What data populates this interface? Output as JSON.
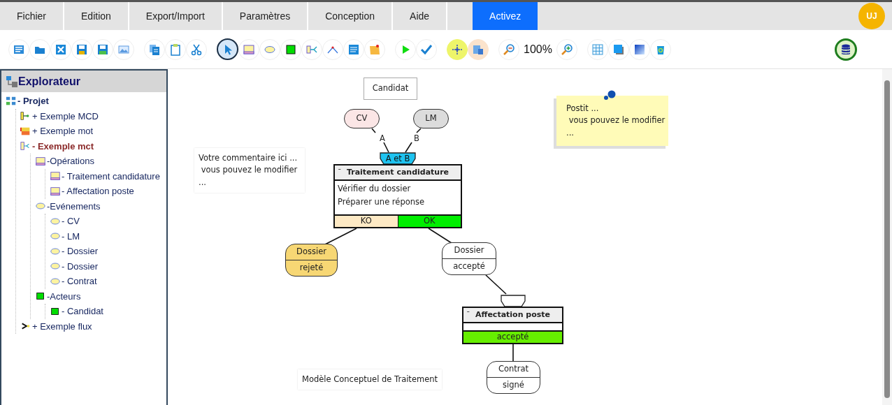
{
  "menu": [
    {
      "label": "Fichier",
      "kind": "menu",
      "selected": false
    },
    {
      "label": "Edition",
      "kind": "menu",
      "selected": false
    },
    {
      "label": "Export/Import",
      "kind": "menu",
      "selected": false
    },
    {
      "label": "Paramètres",
      "kind": "menu",
      "selected": false
    },
    {
      "label": "Conception",
      "kind": "menu",
      "selected": false
    },
    {
      "label": "Aide",
      "kind": "menu",
      "selected": false
    },
    {
      "label": "Activez",
      "kind": "action",
      "selected": true
    }
  ],
  "user": {
    "initials": "UJ"
  },
  "toolbar": {
    "groups": [
      [
        {
          "kind": "form",
          "selected": false
        },
        {
          "kind": "folder",
          "selected": false
        },
        {
          "kind": "close",
          "selected": false
        },
        {
          "kind": "save",
          "selected": false
        },
        {
          "kind": "save-as",
          "selected": false
        },
        {
          "kind": "image",
          "selected": false
        }
      ],
      [
        {
          "kind": "copy",
          "selected": false
        },
        {
          "kind": "paste",
          "selected": false
        },
        {
          "kind": "cut",
          "selected": false
        }
      ],
      [
        {
          "kind": "pointer",
          "selected": true
        },
        {
          "kind": "operation",
          "selected": false
        },
        {
          "kind": "ellipse",
          "selected": false
        },
        {
          "kind": "square",
          "selected": false
        },
        {
          "kind": "branch",
          "selected": false
        },
        {
          "kind": "angle",
          "selected": false
        },
        {
          "kind": "comment",
          "selected": false
        },
        {
          "kind": "note",
          "selected": false
        }
      ],
      [
        {
          "kind": "play",
          "selected": false
        },
        {
          "kind": "check",
          "selected": false
        }
      ],
      [
        {
          "kind": "move",
          "selected": false,
          "color": "#eef56a"
        },
        {
          "kind": "layout",
          "selected": false,
          "color": "#fbe3cc"
        }
      ],
      [
        {
          "kind": "zoom-out",
          "selected": false
        },
        {
          "kind": "text",
          "text": "100%"
        },
        {
          "kind": "zoom-in",
          "selected": false
        }
      ],
      [
        {
          "kind": "grid",
          "selected": false
        },
        {
          "kind": "shadow",
          "selected": false
        },
        {
          "kind": "gradient",
          "selected": false
        },
        {
          "kind": "trash",
          "selected": false
        }
      ]
    ],
    "end_tool": {
      "kind": "database"
    }
  },
  "explorer": {
    "title": "Explorateur",
    "tree": [
      {
        "label": "- Projet",
        "kind": "project",
        "selected": false,
        "children": [
          {
            "label": "+ Exemple MCD",
            "kind": "mcd",
            "selected": false
          },
          {
            "label": "+ Exemple mot",
            "kind": "mot",
            "selected": false
          },
          {
            "label": "- Exemple mct",
            "kind": "mct",
            "selected": true,
            "children": [
              {
                "label": "-Opérations",
                "kind": "operation",
                "selected": false,
                "children": [
                  {
                    "label": "- Traitement candidature",
                    "kind": "operation",
                    "selected": false
                  },
                  {
                    "label": "- Affectation poste",
                    "kind": "operation",
                    "selected": false
                  }
                ]
              },
              {
                "label": "-Evénements",
                "kind": "event",
                "selected": false,
                "children": [
                  {
                    "label": "- CV",
                    "kind": "event",
                    "selected": false
                  },
                  {
                    "label": "- LM",
                    "kind": "event",
                    "selected": false
                  },
                  {
                    "label": "- Dossier",
                    "kind": "event",
                    "selected": false
                  },
                  {
                    "label": "- Dossier",
                    "kind": "event",
                    "selected": false
                  },
                  {
                    "label": "- Contrat",
                    "kind": "event",
                    "selected": false
                  }
                ]
              },
              {
                "label": "-Acteurs",
                "kind": "actor",
                "selected": false,
                "children": [
                  {
                    "label": "- Candidat",
                    "kind": "actor",
                    "selected": false
                  }
                ]
              }
            ]
          },
          {
            "label": "+ Exemple flux",
            "kind": "flux",
            "selected": false
          }
        ]
      }
    ]
  },
  "diagram": {
    "actors": [
      {
        "label": "Candidat"
      }
    ],
    "events": [
      {
        "label": "CV",
        "color": "#fbe6e6"
      },
      {
        "label": "LM",
        "color": "#dcdcdc"
      },
      {
        "label": "Dossier",
        "state": "rejeté",
        "color": "#f7d774"
      },
      {
        "label": "Dossier",
        "state": "accepté",
        "color": "#ffffff"
      },
      {
        "label": "Contrat",
        "state": "signé",
        "color": "#ffffff"
      }
    ],
    "links": [
      {
        "label": "A"
      },
      {
        "label": "B"
      }
    ],
    "operations": [
      {
        "toggle": "ˉ",
        "title": "Traitement candidature",
        "synchro": true,
        "synchro_label": "A et B",
        "actions": [
          "Vérifier du dossier",
          "Préparer une réponse"
        ],
        "outcomes": [
          {
            "label": "KO",
            "color": "#fde9c4"
          },
          {
            "label": "OK",
            "color": "#00ee00"
          }
        ]
      },
      {
        "toggle": "ˉ",
        "title": "Affectation poste",
        "synchro": true,
        "outcomes": [
          {
            "label": "accepté",
            "color": "#66ee00"
          }
        ]
      }
    ],
    "comments": [
      {
        "text": "Votre commentaire ici ...\n vous pouvez le modifier\n..."
      }
    ],
    "caption": "Modèle Conceptuel de Traitement",
    "postit": {
      "text": "Postit ...\n vous pouvez le modifier\n..."
    }
  }
}
